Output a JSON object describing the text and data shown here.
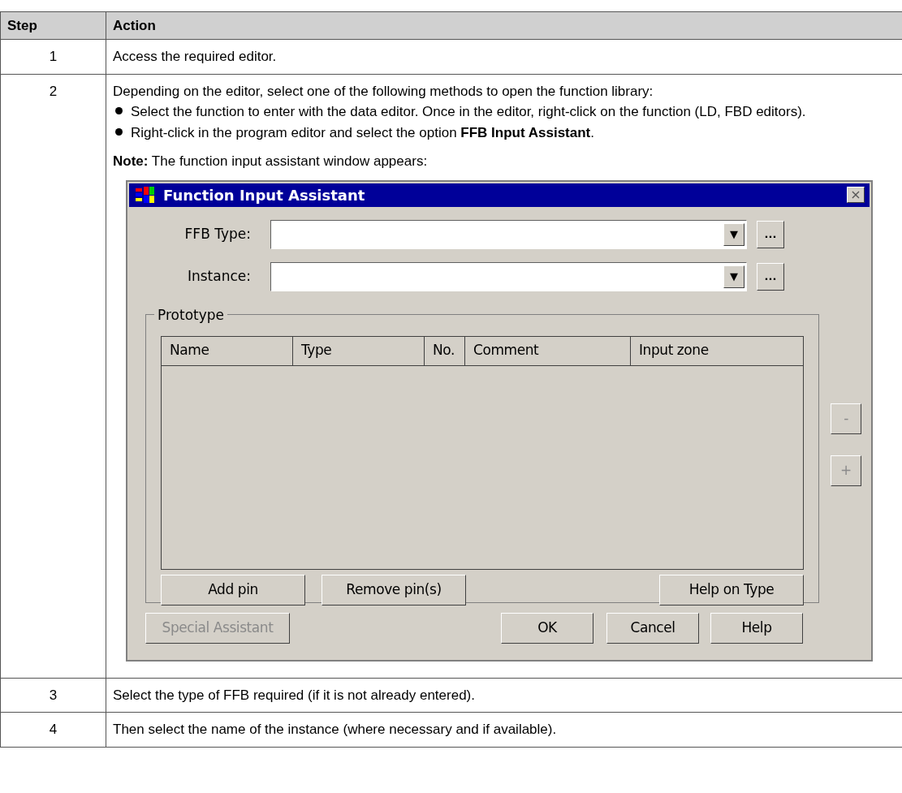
{
  "table": {
    "columns": [
      "Step",
      "Action"
    ],
    "rows": [
      {
        "step": "1",
        "action": "Access the required editor."
      },
      {
        "step": "2",
        "intro": "Depending on the editor, select one of the following methods to open the function library:",
        "bullets": [
          "Select the function to enter with the data editor. Once in the editor, right-click on the function (LD, FBD editors).",
          "Right-click in the program editor and select the option **FFB Input Assistant**."
        ],
        "note": "**Note:** The function input assistant window appears:",
        "dialog": {
          "title": "Function Input Assistant",
          "close": "×",
          "fields": [
            {
              "label": "FFB Type:",
              "arrow": "▼",
              "browse": "..."
            },
            {
              "label": "Instance:",
              "arrow": "▼",
              "browse": "..."
            }
          ],
          "group": "Prototype",
          "columns": [
            "Name",
            "Type",
            "No.",
            "Comment",
            "Input zone"
          ],
          "side_buttons": [
            {
              "label": "-",
              "disabled": true
            },
            {
              "label": "+",
              "disabled": true
            }
          ],
          "group_buttons": [
            {
              "label": "Add pin",
              "disabled": false
            },
            {
              "label": "Remove pin(s)",
              "disabled": false
            },
            {
              "label": "Help on Type",
              "disabled": false
            }
          ],
          "footer_buttons": [
            {
              "label": "Special Assistant",
              "disabled": true
            },
            {
              "label": "OK",
              "disabled": false
            },
            {
              "label": "Cancel",
              "disabled": false
            },
            {
              "label": "Help",
              "disabled": false
            }
          ]
        }
      },
      {
        "step": "3",
        "action": "Select the type of FFB required (if it is not already entered)."
      },
      {
        "step": "4",
        "action": "Then select the name of the instance (where necessary and if available)."
      }
    ]
  }
}
